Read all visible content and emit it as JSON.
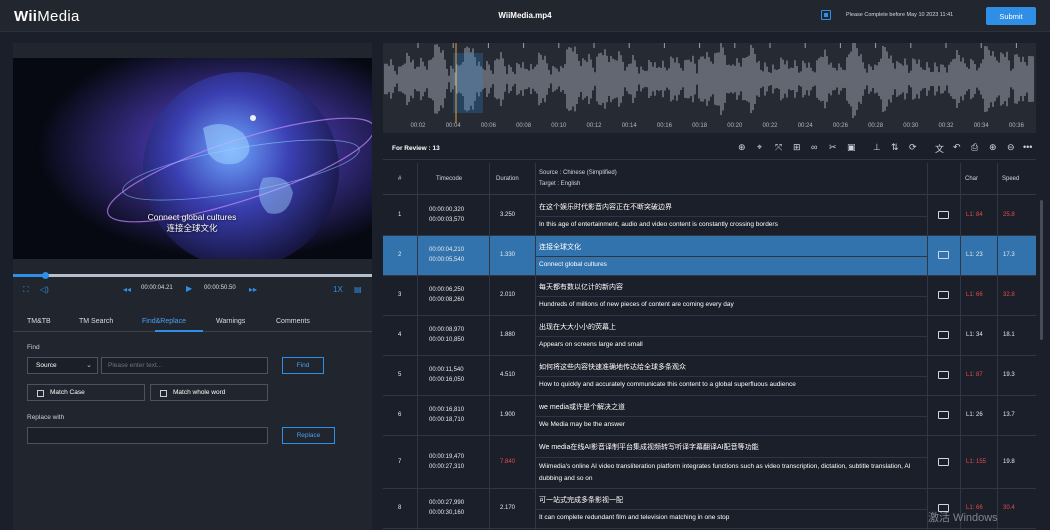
{
  "app": {
    "logo_prefix": "Wii",
    "logo_suffix": "Media",
    "filename": "WiiMedia.mp4",
    "deadline": "Please Complete before May 10 2023 11:41",
    "submit_label": "Submit"
  },
  "player": {
    "subtitle_en": "Connect global cultures",
    "subtitle_zh": "连接全球文化",
    "current_time": "00:00:04.21",
    "total_time": "00:00:50.50",
    "speed": "1X",
    "progress": 0.09
  },
  "tabs": [
    "TM&TB",
    "TM Search",
    "Find&Replace",
    "Warnings",
    "Comments"
  ],
  "active_tab": "Find&Replace",
  "find": {
    "label": "Find",
    "scope_value": "Source",
    "placeholder": "Please enter text...",
    "find_button": "Find",
    "match_case": "Match Case",
    "match_whole_word": "Match whole word"
  },
  "replace": {
    "label": "Replace with",
    "button": "Replace"
  },
  "waveform": {
    "ticks": [
      "00:02",
      "00:04",
      "00:06",
      "00:08",
      "00:10",
      "00:12",
      "00:14",
      "00:16",
      "00:18",
      "00:20",
      "00:22",
      "00:24",
      "00:26",
      "00:28",
      "00:30",
      "00:32",
      "00:34",
      "00:36"
    ]
  },
  "review": {
    "label": "For Review : 13"
  },
  "grid": {
    "headers": {
      "num": "#",
      "timecode": "Timecode",
      "duration": "Duration",
      "source": "Source : Chinese (Simplified)",
      "target": "Target : English",
      "char": "Char",
      "speed": "Speed"
    },
    "rows": [
      {
        "num": "1",
        "start": "00:00:00,320",
        "end": "00:00:03,570",
        "duration": "3.250",
        "source": "在这个娱乐时代影音内容正在不断突破边界",
        "target": "In this age of entertainment, audio and video content is constantly crossing borders",
        "char": "L1: 84",
        "speed": "25.8",
        "char_red": true,
        "speed_red": true,
        "dur_red": false
      },
      {
        "num": "2",
        "start": "00:00:04,210",
        "end": "00:00:05,540",
        "duration": "1.330",
        "source": "连接全球文化",
        "target": "Connect global cultures",
        "char": "L1: 23",
        "speed": "17.3",
        "char_red": false,
        "speed_red": false,
        "dur_red": false
      },
      {
        "num": "3",
        "start": "00:00:06,250",
        "end": "00:00:08,260",
        "duration": "2.010",
        "source": "每天都有数以亿计的新内容",
        "target": "Hundreds of millions of new pieces of content are coming every day",
        "char": "L1: 66",
        "speed": "32.8",
        "char_red": true,
        "speed_red": true,
        "dur_red": false
      },
      {
        "num": "4",
        "start": "00:00:08,970",
        "end": "00:00:10,850",
        "duration": "1.880",
        "source": "出现在大大小小的荧幕上",
        "target": "Appears on screens large and small",
        "char": "L1: 34",
        "speed": "18.1",
        "char_red": false,
        "speed_red": false,
        "dur_red": false
      },
      {
        "num": "5",
        "start": "00:00:11,540",
        "end": "00:00:16,050",
        "duration": "4.510",
        "source": "如何将这些内容快速准确地传达给全球多条观众",
        "target": "How to quickly and accurately communicate this content to a global superfluous audience",
        "char": "L1: 87",
        "speed": "19.3",
        "char_red": true,
        "speed_red": false,
        "dur_red": false
      },
      {
        "num": "6",
        "start": "00:00:16,810",
        "end": "00:00:18,710",
        "duration": "1.900",
        "source": "we media或许是个解决之道",
        "target": "We Media may be the answer",
        "char": "L1: 26",
        "speed": "13.7",
        "char_red": false,
        "speed_red": false,
        "dur_red": false
      },
      {
        "num": "7",
        "start": "00:00:19,470",
        "end": "00:00:27,310",
        "duration": "7.840",
        "source": "We media在线AI影音译制平台集成视频转写听译字幕翻译AI配音等功能",
        "target": "Wiimedia's online AI video transliteration platform integrates functions such as video transcription, dictation, subtitle translation, AI dubbing and so on",
        "char": "L1: 155",
        "speed": "19.8",
        "char_red": true,
        "speed_red": false,
        "dur_red": true
      },
      {
        "num": "8",
        "start": "00:00:27,990",
        "end": "00:00:30,160",
        "duration": "2.170",
        "source": "可一站式完成多条影视一配",
        "target": "It can complete redundant film and television matching in one stop",
        "char": "L1: 66",
        "speed": "30.4",
        "char_red": true,
        "speed_red": true,
        "dur_red": false
      }
    ]
  },
  "watermark": "激活 Windows"
}
